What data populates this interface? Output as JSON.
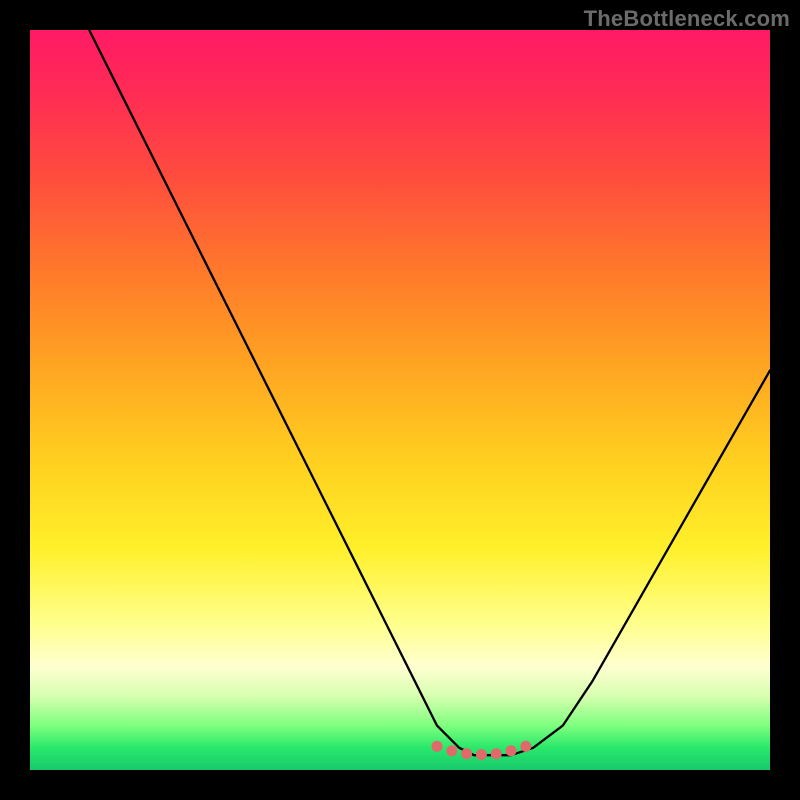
{
  "watermark": "TheBottleneck.com",
  "chart_data": {
    "type": "line",
    "title": "",
    "xlabel": "",
    "ylabel": "",
    "xlim": [
      0,
      100
    ],
    "ylim": [
      0,
      100
    ],
    "grid": false,
    "legend": false,
    "description": "Bottleneck curve on a vertical heatmap gradient. The black curve plunges from the top-left, reaches a flat minimum near the bottom center-right, and rises again toward the right. Background hue maps the same y-value: red/magenta at top (high %) through orange and yellow to green at bottom (low %). Small salmon dots mark the flat trough.",
    "series": [
      {
        "name": "bottleneck-curve",
        "x": [
          8,
          12,
          16,
          20,
          24,
          28,
          32,
          36,
          40,
          44,
          48,
          52,
          55,
          58,
          60,
          62,
          65,
          68,
          72,
          76,
          80,
          84,
          88,
          92,
          96,
          100
        ],
        "y": [
          100,
          92,
          84,
          76,
          68,
          60,
          52,
          44,
          36,
          28,
          20,
          12,
          6,
          3,
          2,
          2,
          2,
          3,
          6,
          12,
          19,
          26,
          33,
          40,
          47,
          54
        ]
      }
    ],
    "trough_markers": {
      "name": "trough-dots",
      "x": [
        55,
        57,
        59,
        61,
        63,
        65,
        67
      ],
      "y": [
        3.2,
        2.6,
        2.2,
        2.1,
        2.2,
        2.6,
        3.2
      ]
    },
    "background_gradient": {
      "orientation": "vertical",
      "stops": [
        {
          "pct": 0,
          "color": "#ff1a66"
        },
        {
          "pct": 20,
          "color": "#ff4d3d"
        },
        {
          "pct": 45,
          "color": "#ffa322"
        },
        {
          "pct": 70,
          "color": "#fff02a"
        },
        {
          "pct": 86,
          "color": "#ffffd0"
        },
        {
          "pct": 94,
          "color": "#7eff7e"
        },
        {
          "pct": 100,
          "color": "#17c96d"
        }
      ]
    }
  }
}
